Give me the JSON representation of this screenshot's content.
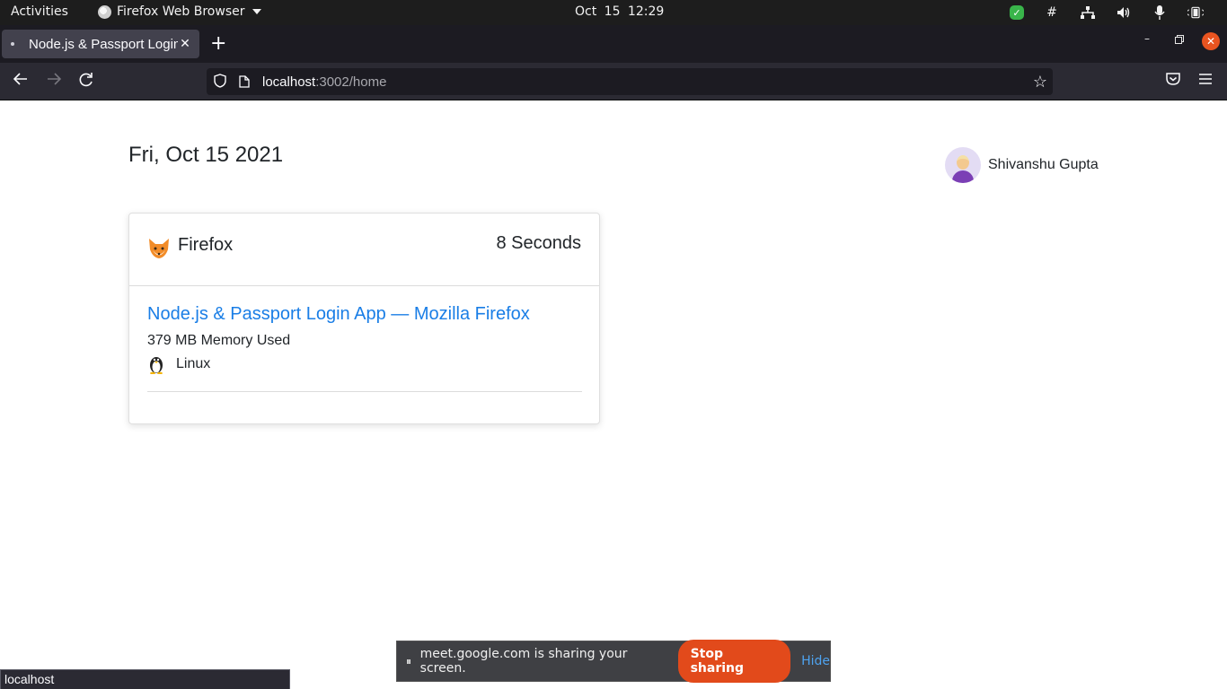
{
  "system": {
    "activities_label": "Activities",
    "app_menu_label": "Firefox Web Browser",
    "clock": "Oct 15  12:29",
    "tray_icons": [
      "check-shield-icon",
      "slack-icon",
      "network-icon",
      "volume-icon",
      "microphone-icon",
      "battery-icon"
    ]
  },
  "browser": {
    "tab_title": "Node.js & Passport Login",
    "url_host": "localhost",
    "url_path": ":3002/home",
    "status_text": "localhost"
  },
  "page": {
    "date_heading": "Fri, Oct 15 2021",
    "user_name": "Shivanshu Gupta",
    "card": {
      "browser_name": "Firefox",
      "duration": "8 Seconds",
      "window_title": "Node.js & Passport Login App — Mozilla Firefox",
      "memory": "379 MB Memory Used",
      "os": "Linux"
    }
  },
  "sharing": {
    "message": "meet.google.com is sharing your screen.",
    "stop_label": "Stop sharing",
    "hide_label": "Hide"
  },
  "colors": {
    "link": "#1a7ee6",
    "stop_button": "#e24a1b",
    "close_window": "#e95420"
  }
}
